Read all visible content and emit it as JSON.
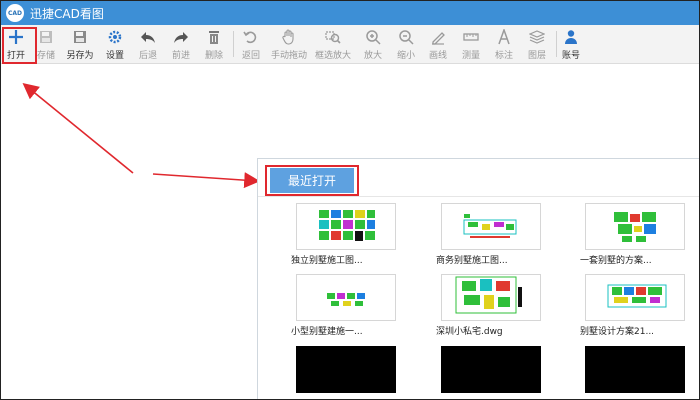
{
  "app": {
    "title": "迅捷CAD看图",
    "logo_text": "CAD"
  },
  "toolbar": {
    "items": [
      {
        "label": "打开",
        "icon": "plus-icon"
      },
      {
        "label": "存储",
        "icon": "save-icon"
      },
      {
        "label": "另存为",
        "icon": "save-as-icon"
      },
      {
        "label": "设置",
        "icon": "gear-icon"
      },
      {
        "label": "后退",
        "icon": "undo-arrow-icon"
      },
      {
        "label": "前进",
        "icon": "redo-arrow-icon"
      },
      {
        "label": "删除",
        "icon": "trash-icon"
      },
      {
        "label": "返回",
        "icon": "return-icon"
      },
      {
        "label": "手动拖动",
        "icon": "hand-icon"
      },
      {
        "label": "框选放大",
        "icon": "box-zoom-icon"
      },
      {
        "label": "放大",
        "icon": "zoom-in-icon"
      },
      {
        "label": "缩小",
        "icon": "zoom-out-icon"
      },
      {
        "label": "画线",
        "icon": "draw-line-icon"
      },
      {
        "label": "测量",
        "icon": "ruler-icon"
      },
      {
        "label": "标注",
        "icon": "annotate-text-icon"
      },
      {
        "label": "图层",
        "icon": "layers-icon"
      },
      {
        "label": "账号",
        "icon": "user-icon"
      }
    ]
  },
  "recent": {
    "button_label": "最近打开",
    "files": [
      {
        "name": "独立别墅施工图..."
      },
      {
        "name": "商务别墅施工图..."
      },
      {
        "name": "一套别墅的方案..."
      },
      {
        "name": "小型别墅建施一..."
      },
      {
        "name": "深圳小私宅.dwg"
      },
      {
        "name": "别墅设计方案21..."
      },
      {
        "name": ""
      },
      {
        "name": ""
      },
      {
        "name": ""
      }
    ]
  },
  "colors": {
    "titlebar": "#3d8fd6",
    "accent_button": "#5ea1e0",
    "highlight_red": "#e0282e"
  }
}
